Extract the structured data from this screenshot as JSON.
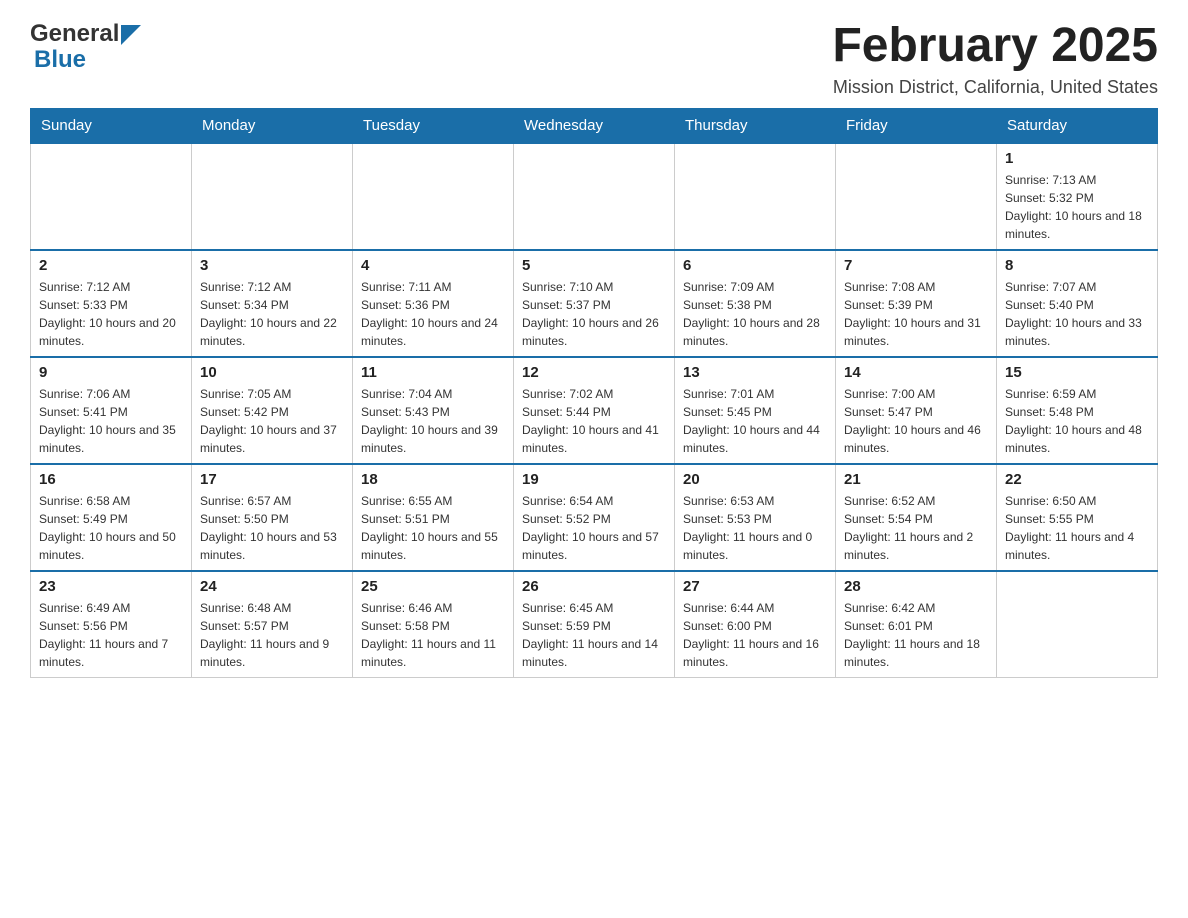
{
  "header": {
    "logo_general": "General",
    "logo_blue": "Blue",
    "title": "February 2025",
    "subtitle": "Mission District, California, United States"
  },
  "calendar": {
    "days_of_week": [
      "Sunday",
      "Monday",
      "Tuesday",
      "Wednesday",
      "Thursday",
      "Friday",
      "Saturday"
    ],
    "weeks": [
      [
        {
          "day": "",
          "info": ""
        },
        {
          "day": "",
          "info": ""
        },
        {
          "day": "",
          "info": ""
        },
        {
          "day": "",
          "info": ""
        },
        {
          "day": "",
          "info": ""
        },
        {
          "day": "",
          "info": ""
        },
        {
          "day": "1",
          "info": "Sunrise: 7:13 AM\nSunset: 5:32 PM\nDaylight: 10 hours and 18 minutes."
        }
      ],
      [
        {
          "day": "2",
          "info": "Sunrise: 7:12 AM\nSunset: 5:33 PM\nDaylight: 10 hours and 20 minutes."
        },
        {
          "day": "3",
          "info": "Sunrise: 7:12 AM\nSunset: 5:34 PM\nDaylight: 10 hours and 22 minutes."
        },
        {
          "day": "4",
          "info": "Sunrise: 7:11 AM\nSunset: 5:36 PM\nDaylight: 10 hours and 24 minutes."
        },
        {
          "day": "5",
          "info": "Sunrise: 7:10 AM\nSunset: 5:37 PM\nDaylight: 10 hours and 26 minutes."
        },
        {
          "day": "6",
          "info": "Sunrise: 7:09 AM\nSunset: 5:38 PM\nDaylight: 10 hours and 28 minutes."
        },
        {
          "day": "7",
          "info": "Sunrise: 7:08 AM\nSunset: 5:39 PM\nDaylight: 10 hours and 31 minutes."
        },
        {
          "day": "8",
          "info": "Sunrise: 7:07 AM\nSunset: 5:40 PM\nDaylight: 10 hours and 33 minutes."
        }
      ],
      [
        {
          "day": "9",
          "info": "Sunrise: 7:06 AM\nSunset: 5:41 PM\nDaylight: 10 hours and 35 minutes."
        },
        {
          "day": "10",
          "info": "Sunrise: 7:05 AM\nSunset: 5:42 PM\nDaylight: 10 hours and 37 minutes."
        },
        {
          "day": "11",
          "info": "Sunrise: 7:04 AM\nSunset: 5:43 PM\nDaylight: 10 hours and 39 minutes."
        },
        {
          "day": "12",
          "info": "Sunrise: 7:02 AM\nSunset: 5:44 PM\nDaylight: 10 hours and 41 minutes."
        },
        {
          "day": "13",
          "info": "Sunrise: 7:01 AM\nSunset: 5:45 PM\nDaylight: 10 hours and 44 minutes."
        },
        {
          "day": "14",
          "info": "Sunrise: 7:00 AM\nSunset: 5:47 PM\nDaylight: 10 hours and 46 minutes."
        },
        {
          "day": "15",
          "info": "Sunrise: 6:59 AM\nSunset: 5:48 PM\nDaylight: 10 hours and 48 minutes."
        }
      ],
      [
        {
          "day": "16",
          "info": "Sunrise: 6:58 AM\nSunset: 5:49 PM\nDaylight: 10 hours and 50 minutes."
        },
        {
          "day": "17",
          "info": "Sunrise: 6:57 AM\nSunset: 5:50 PM\nDaylight: 10 hours and 53 minutes."
        },
        {
          "day": "18",
          "info": "Sunrise: 6:55 AM\nSunset: 5:51 PM\nDaylight: 10 hours and 55 minutes."
        },
        {
          "day": "19",
          "info": "Sunrise: 6:54 AM\nSunset: 5:52 PM\nDaylight: 10 hours and 57 minutes."
        },
        {
          "day": "20",
          "info": "Sunrise: 6:53 AM\nSunset: 5:53 PM\nDaylight: 11 hours and 0 minutes."
        },
        {
          "day": "21",
          "info": "Sunrise: 6:52 AM\nSunset: 5:54 PM\nDaylight: 11 hours and 2 minutes."
        },
        {
          "day": "22",
          "info": "Sunrise: 6:50 AM\nSunset: 5:55 PM\nDaylight: 11 hours and 4 minutes."
        }
      ],
      [
        {
          "day": "23",
          "info": "Sunrise: 6:49 AM\nSunset: 5:56 PM\nDaylight: 11 hours and 7 minutes."
        },
        {
          "day": "24",
          "info": "Sunrise: 6:48 AM\nSunset: 5:57 PM\nDaylight: 11 hours and 9 minutes."
        },
        {
          "day": "25",
          "info": "Sunrise: 6:46 AM\nSunset: 5:58 PM\nDaylight: 11 hours and 11 minutes."
        },
        {
          "day": "26",
          "info": "Sunrise: 6:45 AM\nSunset: 5:59 PM\nDaylight: 11 hours and 14 minutes."
        },
        {
          "day": "27",
          "info": "Sunrise: 6:44 AM\nSunset: 6:00 PM\nDaylight: 11 hours and 16 minutes."
        },
        {
          "day": "28",
          "info": "Sunrise: 6:42 AM\nSunset: 6:01 PM\nDaylight: 11 hours and 18 minutes."
        },
        {
          "day": "",
          "info": ""
        }
      ]
    ]
  }
}
